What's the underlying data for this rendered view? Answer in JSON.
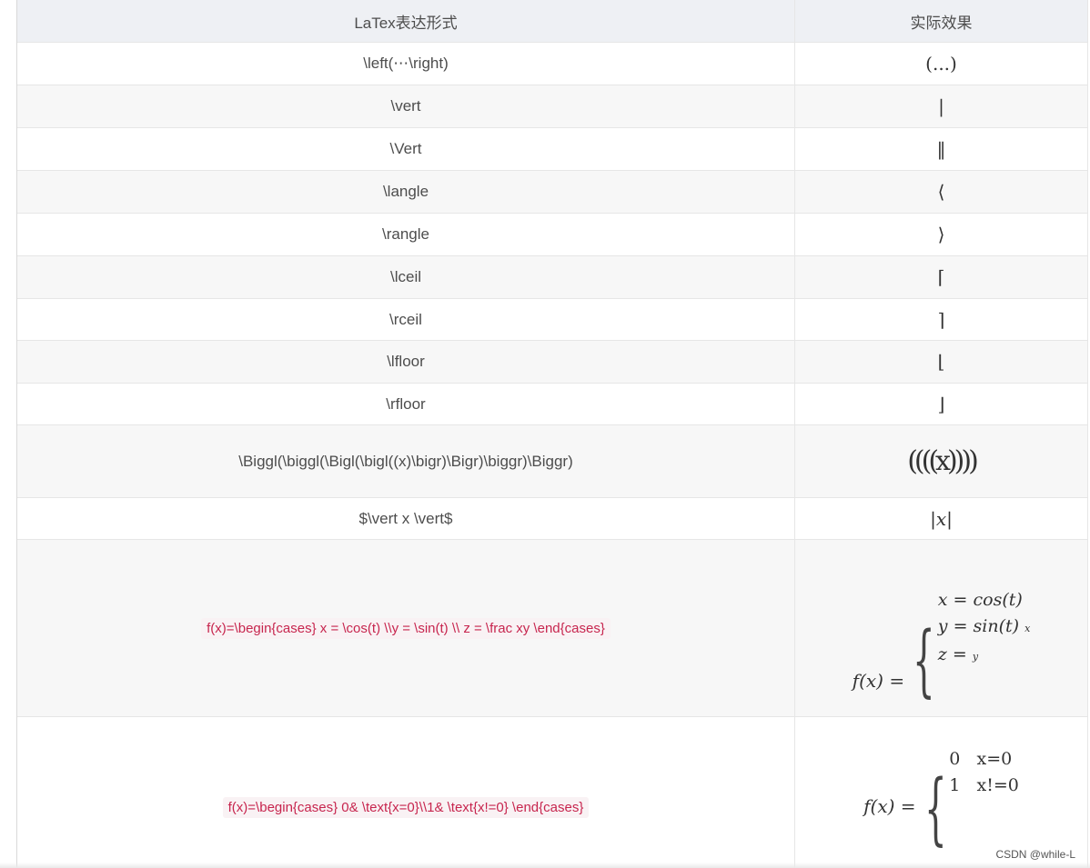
{
  "headers": {
    "col1": "LaTex表达形式",
    "col2": "实际效果"
  },
  "rows": [
    {
      "latex": "\\left(⋯\\right)",
      "result": "(...)"
    },
    {
      "latex": "\\vert",
      "result": "|"
    },
    {
      "latex": "\\Vert",
      "result": "‖"
    },
    {
      "latex": "\\langle",
      "result": "⟨"
    },
    {
      "latex": "\\rangle",
      "result": "⟩"
    },
    {
      "latex": "\\lceil",
      "result": "⌈"
    },
    {
      "latex": "\\rceil",
      "result": "⌉"
    },
    {
      "latex": "\\lfloor",
      "result": "⌊"
    },
    {
      "latex": "\\rfloor",
      "result": "⌋"
    },
    {
      "latex": "\\Biggl(\\biggl(\\Bigl(\\bigl((x)\\bigr)\\Bigr)\\biggr)\\Biggr)",
      "result": "((((x))))"
    },
    {
      "latex": "$\\vert x \\vert$",
      "result": "|x|"
    }
  ],
  "cases1": {
    "latex": "f(x)=\\begin{cases} x = \\cos(t) \\\\y = \\sin(t) \\\\ z = \\frac xy \\end{cases}",
    "fx": "f(x) =",
    "line1": "x = cos(t)",
    "line2": "y = sin(t)",
    "line2_sub": "x",
    "line3": "z =",
    "line3_sub": "y"
  },
  "cases2": {
    "latex": "f(x)=\\begin{cases} 0& \\text{x=0}\\\\1& \\text{x!=0} \\end{cases}",
    "fx": "f(x) =",
    "line1": "0   x=0",
    "line2": "1   x!=0"
  },
  "watermark": "CSDN @while-L"
}
